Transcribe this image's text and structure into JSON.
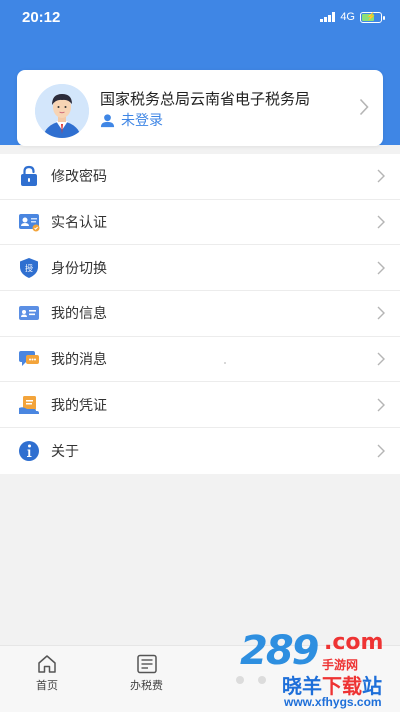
{
  "status_bar": {
    "time": "20:12",
    "network": "4G"
  },
  "profile": {
    "org_name": "国家税务总局云南省电子税务局",
    "login_status": "未登录",
    "avatar_icon": "user-avatar-icon"
  },
  "menu": {
    "items": [
      {
        "label": "修改密码",
        "icon": "lock-icon"
      },
      {
        "label": "实名认证",
        "icon": "id-card-icon"
      },
      {
        "label": "身份切换",
        "icon": "shield-icon"
      },
      {
        "label": "我的信息",
        "icon": "info-card-icon"
      },
      {
        "label": "我的消息",
        "icon": "message-icon"
      },
      {
        "label": "我的凭证",
        "icon": "voucher-icon"
      },
      {
        "label": "关于",
        "icon": "about-info-icon"
      }
    ]
  },
  "tabbar": {
    "tabs": [
      {
        "label": "首页",
        "icon": "home-icon"
      },
      {
        "label": "办税费",
        "icon": "list-icon"
      }
    ]
  },
  "watermark": {
    "big": "289",
    "com": ".com",
    "sub": "手游网",
    "cn_a": "晓羊",
    "cn_b": "下载",
    "cn_c": "站",
    "url": "www.xfhygs.com"
  },
  "colors": {
    "primary": "#3f86e5",
    "background": "#f2f2f2"
  }
}
